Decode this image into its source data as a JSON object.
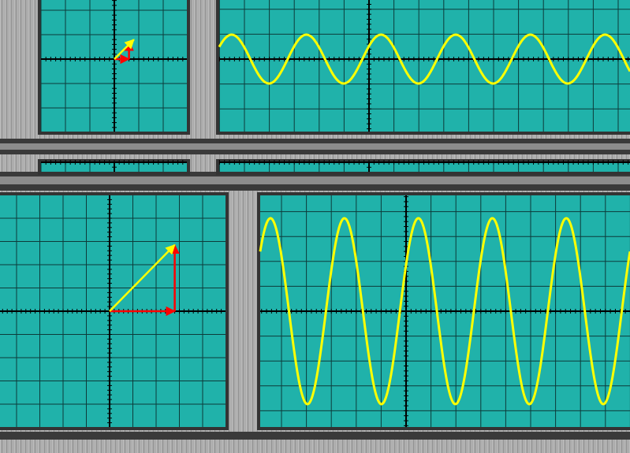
{
  "colors": {
    "screen": "#20b2aa",
    "grid": "#0d3b3a",
    "bezel": "#333333",
    "metal": "#a6a6a6",
    "wave": "#ffff00",
    "phasor": "#ffff00",
    "component": "#ff0000",
    "axis": "#000000"
  },
  "panels": [
    {
      "name": "small-oscilloscope",
      "phasor": {
        "resultant": [
          0.8,
          0.8
        ],
        "horizontal": [
          0.6,
          0
        ],
        "vertical": [
          0,
          0.7
        ]
      },
      "wave": {
        "amplitude": 1.0,
        "cycles_visible": 5.5,
        "phase_deg": 30
      }
    },
    {
      "name": "large-oscilloscope",
      "phasor": {
        "resultant": [
          2.8,
          2.85
        ],
        "horizontal": [
          2.8,
          0
        ],
        "vertical": [
          0,
          2.85
        ]
      },
      "wave": {
        "amplitude": 4.0,
        "cycles_visible": 5.0,
        "phase_deg": 40
      }
    }
  ]
}
